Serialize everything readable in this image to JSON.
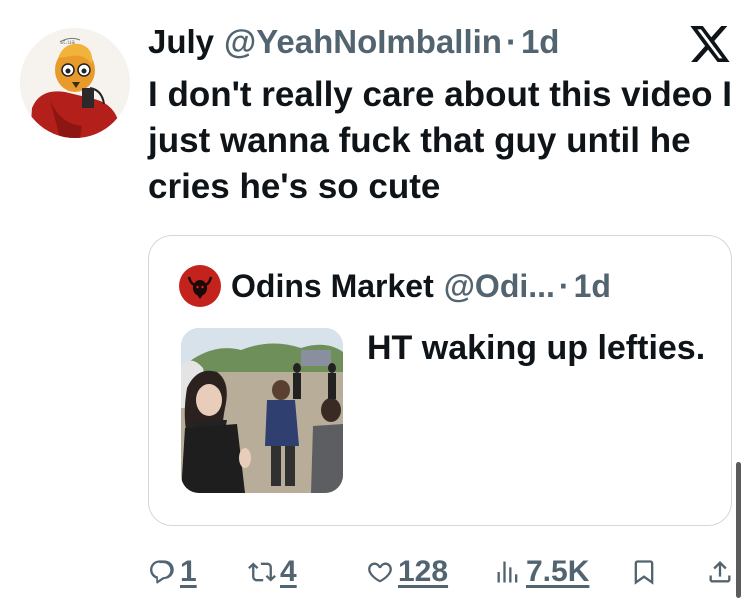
{
  "author": {
    "display_name": "July",
    "handle": "@YeahNoImballin",
    "time": "1d",
    "dot": "·"
  },
  "tweet": {
    "text": "I don't really care about this video I just wanna fuck that guy until he cries he's so cute"
  },
  "quoted": {
    "display_name": "Odins Market",
    "handle": "@Odi...",
    "time": "1d",
    "dot": "·",
    "text": "HT waking up lefties."
  },
  "actions": {
    "replies": "1",
    "reposts": "4",
    "likes": "128",
    "views": "7.5K"
  },
  "icons": {
    "platform_logo": "x-logo-icon",
    "reply": "reply-icon",
    "repost": "repost-icon",
    "like": "heart-icon",
    "views": "views-chart-icon",
    "bookmark": "bookmark-icon",
    "share": "share-icon"
  },
  "colors": {
    "text_primary": "#0f1419",
    "text_secondary": "#536471",
    "border": "#cfd9de",
    "quoted_avatar": "#c4231d"
  }
}
